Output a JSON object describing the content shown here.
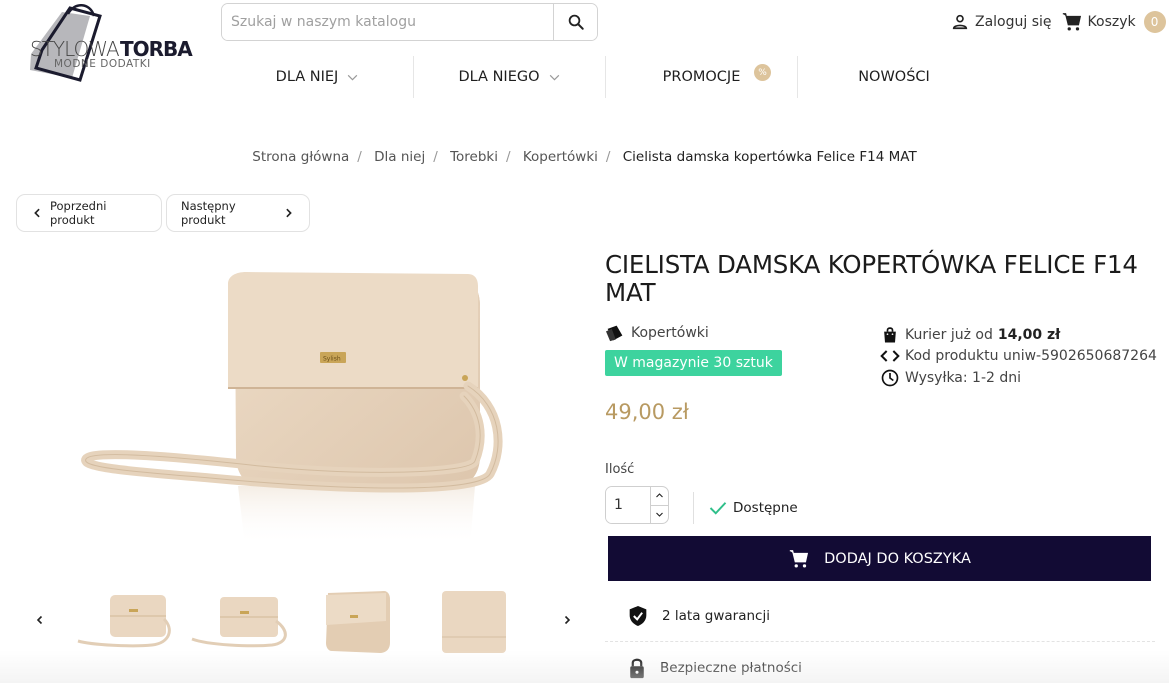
{
  "logo": {
    "word_light": "STYLOWA",
    "word_bold": "TORBA",
    "tagline": "MODNE DODATKI"
  },
  "search": {
    "placeholder": "Szukaj w naszym katalogu"
  },
  "user": {
    "login_label": "Zaloguj się",
    "cart_label": "Koszyk",
    "cart_count": "0"
  },
  "nav": {
    "items": [
      {
        "label": "DLA NIEJ"
      },
      {
        "label": "DLA NIEGO"
      },
      {
        "label": "PROMOCJE",
        "badge": "%"
      },
      {
        "label": "NOWOŚCI"
      }
    ]
  },
  "breadcrumb": [
    "Strona główna",
    "Dla niej",
    "Torebki",
    "Kopertówki",
    "Cielista damska kopertówka Felice F14 MAT"
  ],
  "pagination": {
    "prev_label": "Poprzedni produkt",
    "next_label": "Następny produkt"
  },
  "product": {
    "title": "CIELISTA DAMSKA KOPERTÓWKA FELICE F14 MAT",
    "category": "Kopertówki",
    "stock_badge": "W magazynie 30 sztuk",
    "courier_prefix": "Kurier już od",
    "courier_price": "14,00 zł",
    "product_code": "Kod produktu uniw-5902650687264",
    "shipping": "Wysyłka: 1-2 dni",
    "price": "49,00 zł",
    "qty_label": "Ilość",
    "qty_value": "1",
    "availability": "Dostępne",
    "add_to_cart": "DODAJ DO KOSZYKA",
    "brand_tag": "Sylish",
    "features": [
      "2 lata gwarancji",
      "Bezpieczne płatności"
    ]
  },
  "colors": {
    "accent_gold": "#ddc49c",
    "price": "#b89a62",
    "cta": "#120b34",
    "stock": "#3dd39e",
    "bag": "#e8d4bd"
  }
}
